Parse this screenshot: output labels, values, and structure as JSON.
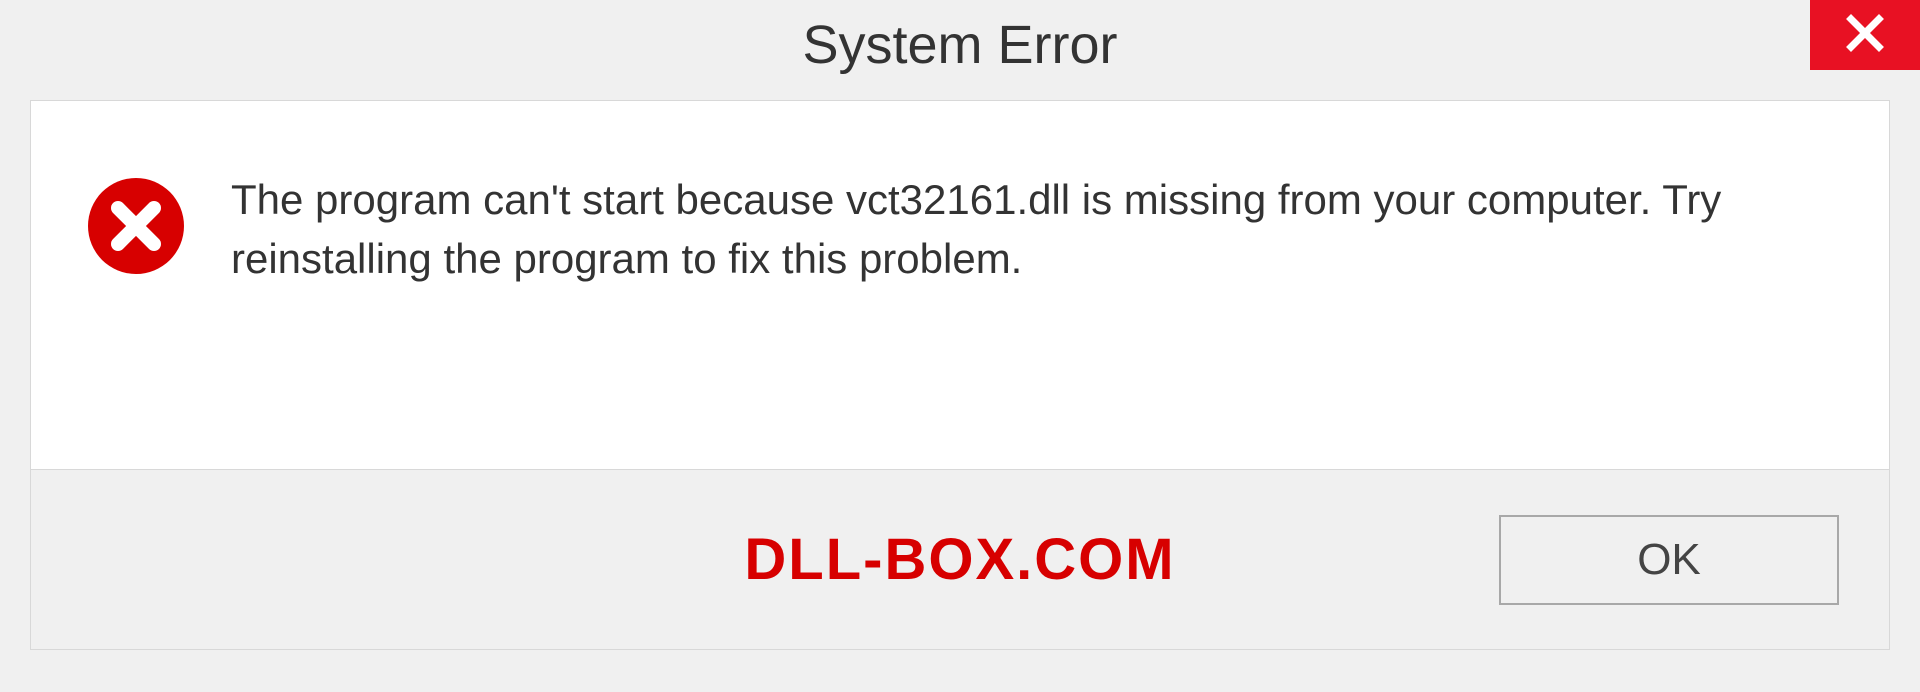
{
  "titlebar": {
    "title": "System Error"
  },
  "dialog": {
    "message": "The program can't start because vct32161.dll is missing from your computer. Try reinstalling the program to fix this problem."
  },
  "footer": {
    "watermark": "DLL-BOX.COM",
    "ok_label": "OK"
  },
  "colors": {
    "close_bg": "#e81123",
    "error_red": "#d70000",
    "watermark_red": "#d70000"
  }
}
